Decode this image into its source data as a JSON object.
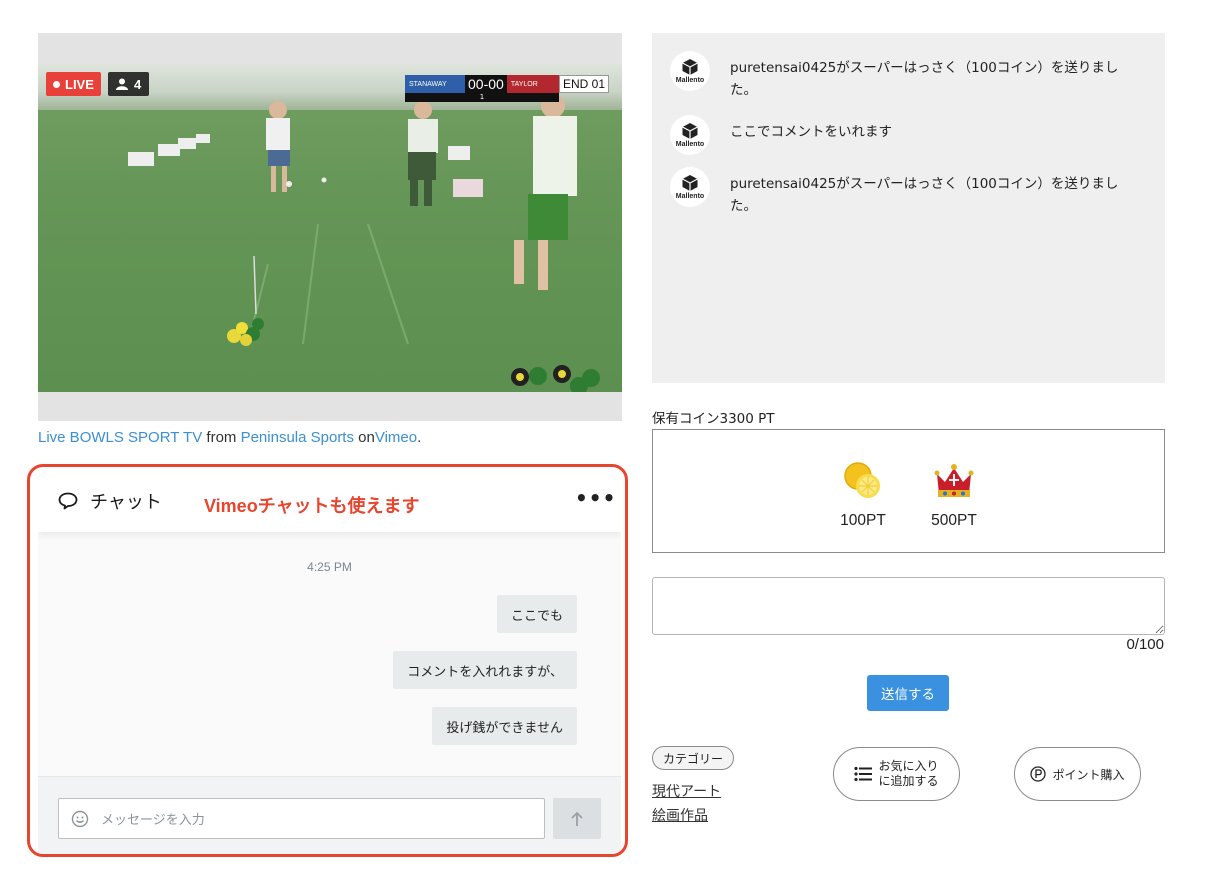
{
  "video": {
    "live_label": "LIVE",
    "viewer_count": "4",
    "scoreboard": {
      "team_a": "STANAWAY",
      "score": "00-00",
      "team_b": "TAYLOR",
      "end": "END 01",
      "sub": "1"
    },
    "caption": {
      "title_link": "Live BOWLS SPORT TV",
      "from": "from",
      "channel_link": "Peninsula Sports",
      "on": "on",
      "site_link": "Vimeo",
      "period": "."
    }
  },
  "chat": {
    "title": "チャット",
    "annotation": "Vimeoチャットも使えます",
    "more": "•••",
    "time": "4:25 PM",
    "messages": [
      {
        "text": "ここでも"
      },
      {
        "text": "コメントを入れれますが、"
      },
      {
        "text": "投げ銭ができません"
      }
    ],
    "input_placeholder": "メッセージを入力",
    "accent_color": "#e8452e"
  },
  "comments": [
    {
      "avatar_brand": "Mallento",
      "text": "puretensai0425がスーパーはっさく（100コイン）を送りました。"
    },
    {
      "avatar_brand": "Mallento",
      "text": "ここでコメントをいれます"
    },
    {
      "avatar_brand": "Mallento",
      "text": "puretensai0425がスーパーはっさく（100コイン）を送りました。"
    }
  ],
  "coins": {
    "label": "保有コイン3300 PT"
  },
  "gifts": [
    {
      "icon": "grapefruit-icon",
      "label": "100PT"
    },
    {
      "icon": "crown-icon",
      "label": "500PT"
    }
  ],
  "comment_form": {
    "value": "",
    "char_count": "0/100",
    "send_label": "送信する",
    "send_color": "#3a91df"
  },
  "category": {
    "pill": "カテゴリー",
    "links": [
      "現代アート",
      "絵画作品"
    ]
  },
  "actions": {
    "favorite_line1": "お気に入り",
    "favorite_line2": "に追加する",
    "buy_points": "ポイント購入"
  }
}
